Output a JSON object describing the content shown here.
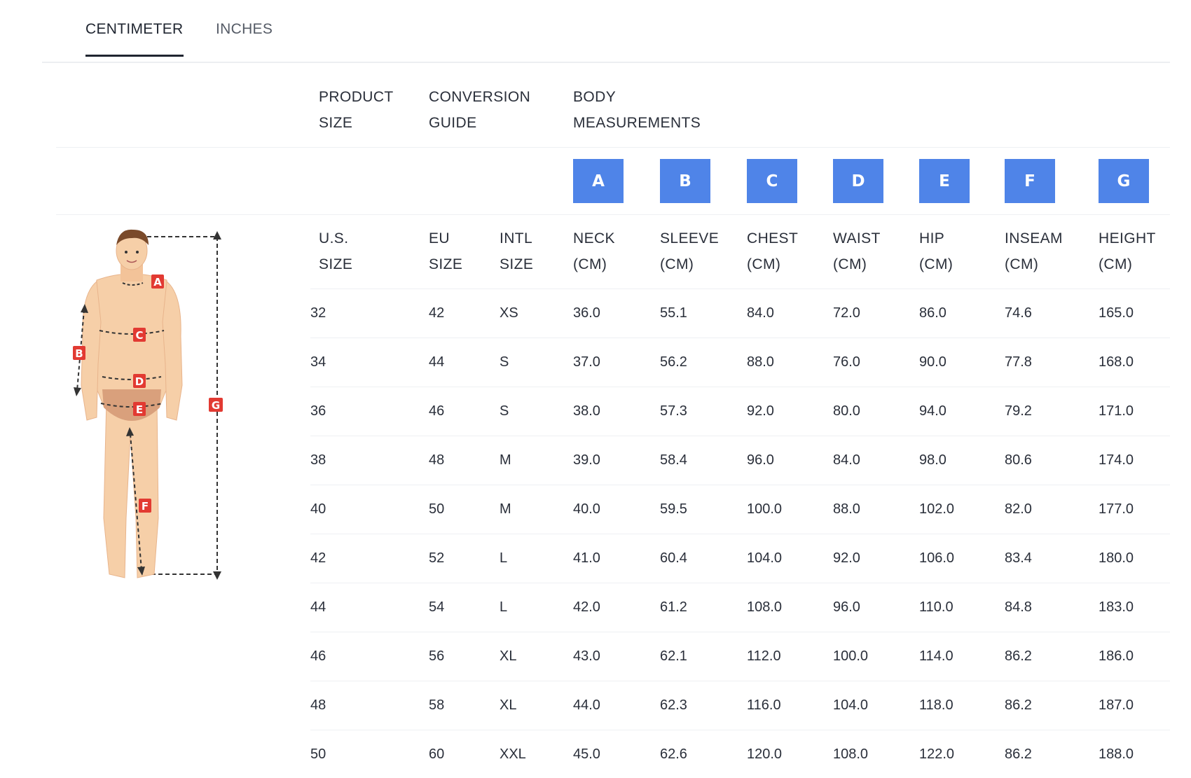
{
  "tabs": [
    {
      "label": "CENTIMETER",
      "active": true
    },
    {
      "label": "INCHES",
      "active": false
    }
  ],
  "group_headers": {
    "product_size": [
      "PRODUCT",
      "SIZE"
    ],
    "conversion_guide": [
      "CONVERSION",
      "GUIDE"
    ],
    "body_measurements": [
      "BODY",
      "MEASUREMENTS"
    ]
  },
  "figure_markers": [
    "A",
    "B",
    "C",
    "D",
    "E",
    "F",
    "G"
  ],
  "measurement_keys": [
    "A",
    "B",
    "C",
    "D",
    "E",
    "F",
    "G"
  ],
  "columns": [
    {
      "line1": "U.S.",
      "line2": "SIZE"
    },
    {
      "line1": "EU",
      "line2": "SIZE"
    },
    {
      "line1": "INTL",
      "line2": "SIZE"
    },
    {
      "line1": "NECK",
      "line2": "(CM)"
    },
    {
      "line1": "SLEEVE",
      "line2": "(CM)"
    },
    {
      "line1": "CHEST",
      "line2": "(CM)"
    },
    {
      "line1": "WAIST",
      "line2": "(CM)"
    },
    {
      "line1": "HIP",
      "line2": "(CM)"
    },
    {
      "line1": "INSEAM",
      "line2": "(CM)"
    },
    {
      "line1": "HEIGHT",
      "line2": "(CM)"
    }
  ],
  "rows": [
    [
      "32",
      "42",
      "XS",
      "36.0",
      "55.1",
      "84.0",
      "72.0",
      "86.0",
      "74.6",
      "165.0"
    ],
    [
      "34",
      "44",
      "S",
      "37.0",
      "56.2",
      "88.0",
      "76.0",
      "90.0",
      "77.8",
      "168.0"
    ],
    [
      "36",
      "46",
      "S",
      "38.0",
      "57.3",
      "92.0",
      "80.0",
      "94.0",
      "79.2",
      "171.0"
    ],
    [
      "38",
      "48",
      "M",
      "39.0",
      "58.4",
      "96.0",
      "84.0",
      "98.0",
      "80.6",
      "174.0"
    ],
    [
      "40",
      "50",
      "M",
      "40.0",
      "59.5",
      "100.0",
      "88.0",
      "102.0",
      "82.0",
      "177.0"
    ],
    [
      "42",
      "52",
      "L",
      "41.0",
      "60.4",
      "104.0",
      "92.0",
      "106.0",
      "83.4",
      "180.0"
    ],
    [
      "44",
      "54",
      "L",
      "42.0",
      "61.2",
      "108.0",
      "96.0",
      "110.0",
      "84.8",
      "183.0"
    ],
    [
      "46",
      "56",
      "XL",
      "43.0",
      "62.1",
      "112.0",
      "100.0",
      "114.0",
      "86.2",
      "186.0"
    ],
    [
      "48",
      "58",
      "XL",
      "44.0",
      "62.3",
      "116.0",
      "104.0",
      "118.0",
      "86.2",
      "187.0"
    ],
    [
      "50",
      "60",
      "XXL",
      "45.0",
      "62.6",
      "120.0",
      "108.0",
      "122.0",
      "86.2",
      "188.0"
    ]
  ],
  "colors": {
    "badge": "#4f84e8",
    "marker": "#e23a32",
    "skin": "#f6cfa8",
    "hair": "#7a4a2a"
  }
}
